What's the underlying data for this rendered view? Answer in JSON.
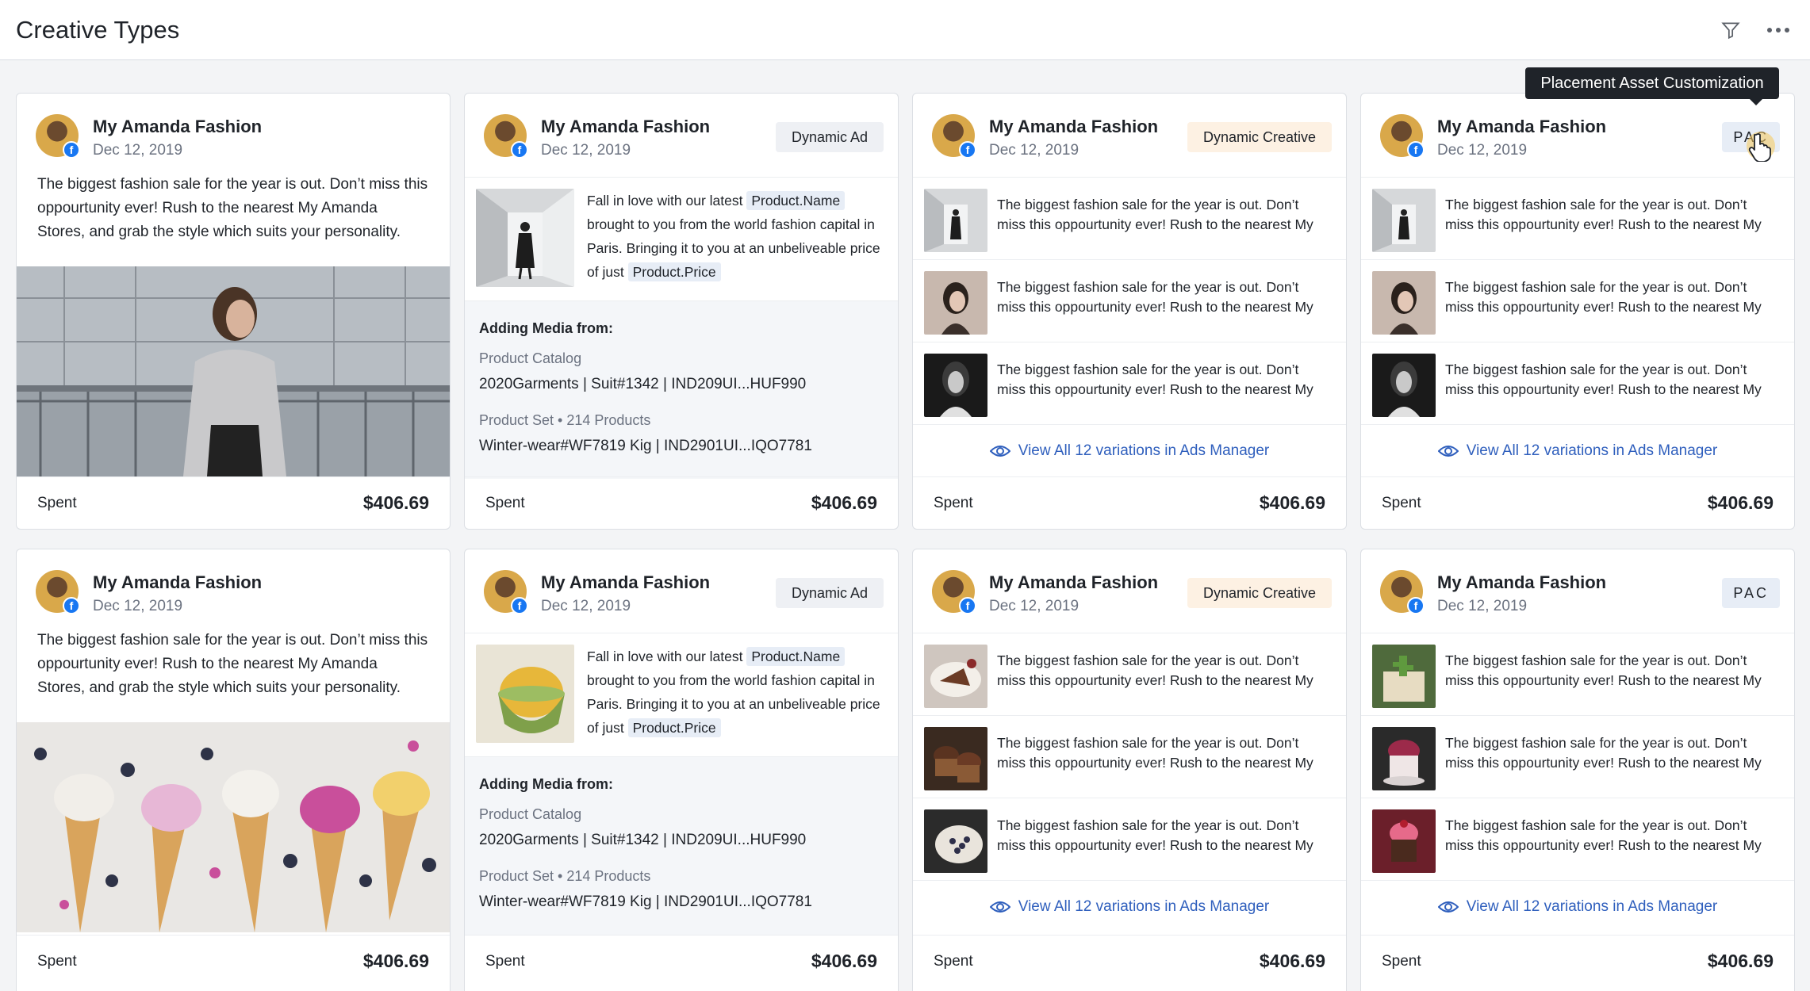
{
  "header": {
    "title": "Creative Types",
    "filter_icon": "filter-icon",
    "more_icon": "more-horizontal-icon"
  },
  "tooltip": {
    "text": "Placement Asset Customization"
  },
  "colors": {
    "accent_link": "#2f5fbd",
    "facebook": "#1877f2",
    "dynamic_creative_badge": "#fdf1e3",
    "pac_badge": "#e7edf6",
    "dynamic_ad_badge": "#eef0f4"
  },
  "cards": {
    "r1c1": {
      "brand": "My Amanda Fashion",
      "date": "Dec 12, 2019",
      "text": "The biggest fashion sale for the year is out. Don’t miss this oppourtunity ever! Rush to the nearest My Amanda Stores, and grab the style which suits your personality.",
      "image": "woman-in-grey-sweater-photo",
      "spent_label": "Spent",
      "spent_value": "$406.69"
    },
    "r1c2": {
      "brand": "My Amanda Fashion",
      "date": "Dec 12, 2019",
      "badge": "Dynamic Ad",
      "text_a": "Fall in love with our latest ",
      "token_a": "Product.Name",
      "text_b": " brought to you from the world fashion capital in Paris. Bringing it to you at an unbeliveable price of just ",
      "token_b": "Product.Price",
      "media_title": "Adding Media from:",
      "catalog_label": "Product Catalog",
      "catalog_value": "2020Garments | Suit#1342 | IND209UI...HUF990",
      "set_label": "Product Set • 214 Products",
      "set_value": "Winter-wear#WF7819 Kig | IND2901UI...IQO7781",
      "spent_label": "Spent",
      "spent_value": "$406.69"
    },
    "r1c3": {
      "brand": "My Amanda Fashion",
      "date": "Dec 12, 2019",
      "badge": "Dynamic Creative",
      "var_text": "The biggest fashion sale for the year is out. Don’t miss this oppourtunity ever! Rush to the nearest My",
      "link": "View All 12 variations in Ads Manager",
      "spent_label": "Spent",
      "spent_value": "$406.69"
    },
    "r1c4": {
      "brand": "My Amanda Fashion",
      "date": "Dec 12, 2019",
      "badge": "PAC",
      "var_text": "The biggest fashion sale for the year is out. Don’t miss this oppourtunity ever! Rush to the nearest My",
      "link": "View All 12 variations in Ads Manager",
      "spent_label": "Spent",
      "spent_value": "$406.69"
    },
    "r2c1": {
      "brand": "My Amanda Fashion",
      "date": "Dec 12, 2019",
      "text": "The biggest fashion sale for the year is out. Don’t miss this oppourtunity ever! Rush to the nearest My Amanda Stores, and grab the style which suits your personality.",
      "image": "ice-cream-cones-photo",
      "spent_label": "Spent",
      "spent_value": "$406.69"
    },
    "r2c2": {
      "brand": "My Amanda Fashion",
      "date": "Dec 12, 2019",
      "badge": "Dynamic Ad",
      "text_a": "Fall in love with our latest ",
      "token_a": "Product.Name",
      "text_b": " brought to you from the world fashion capital in Paris. Bringing it to you at an unbeliveable price of just ",
      "token_b": "Product.Price",
      "media_title": "Adding Media from:",
      "catalog_label": "Product Catalog",
      "catalog_value": "2020Garments | Suit#1342 | IND209UI...HUF990",
      "set_label": "Product Set • 214 Products",
      "set_value": "Winter-wear#WF7819 Kig | IND2901UI...IQO7781",
      "spent_label": "Spent",
      "spent_value": "$406.69"
    },
    "r2c3": {
      "brand": "My Amanda Fashion",
      "date": "Dec 12, 2019",
      "badge": "Dynamic Creative",
      "var_text": "The biggest fashion sale for the year is out. Don’t miss this oppourtunity ever! Rush to the nearest My",
      "link": "View All 12 variations in Ads Manager",
      "spent_label": "Spent",
      "spent_value": "$406.69"
    },
    "r2c4": {
      "brand": "My Amanda Fashion",
      "date": "Dec 12, 2019",
      "badge": "PAC",
      "var_text": "The biggest fashion sale for the year is out. Don’t miss this oppourtunity ever! Rush to the nearest My",
      "link": "View All 12 variations in Ads Manager",
      "spent_label": "Spent",
      "spent_value": "$406.69"
    }
  }
}
